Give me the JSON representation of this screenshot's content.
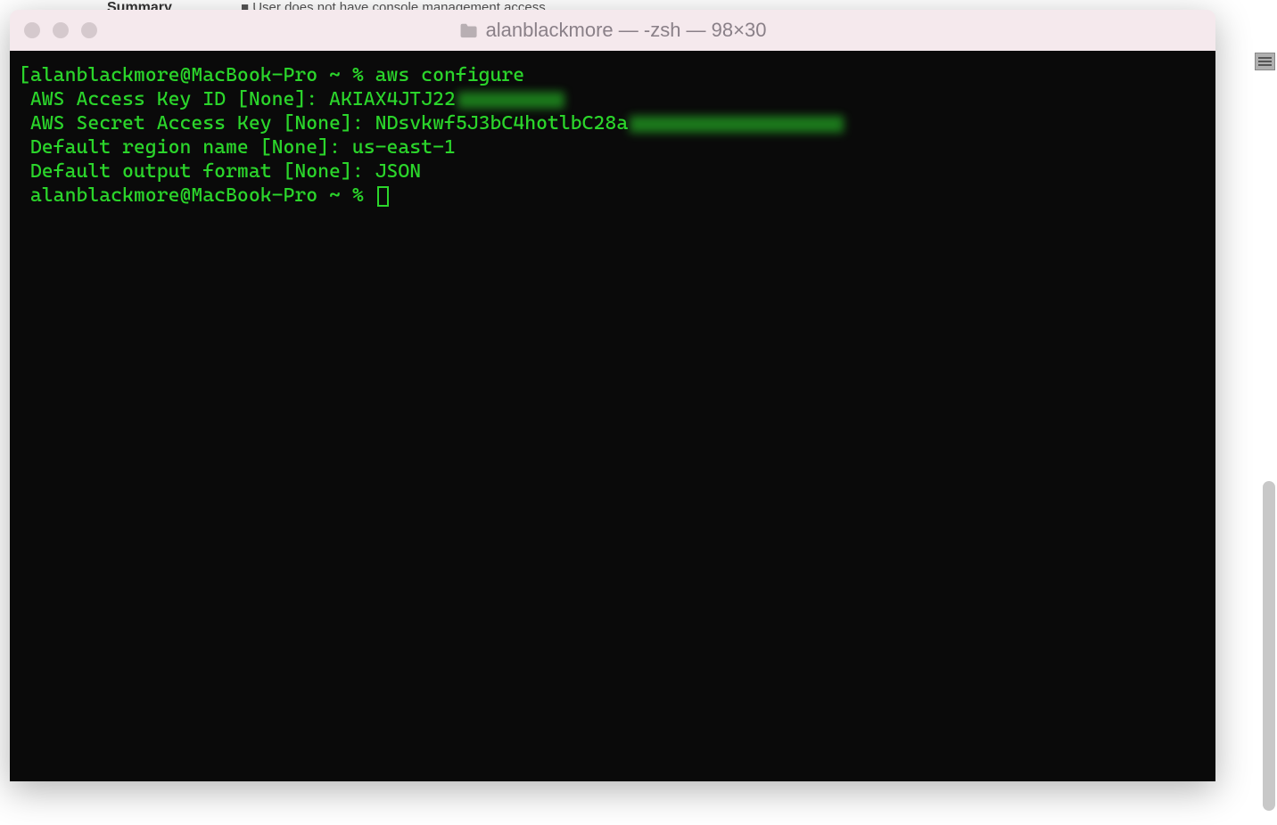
{
  "background": {
    "summary_label": "Summary",
    "summary_bullet": "■ User does not have console management access"
  },
  "titlebar": {
    "title": "alanblackmore — -zsh — 98×30"
  },
  "terminal": {
    "line1_prefix": "[",
    "line1_prompt": "alanblackmore@MacBook-Pro ~ % ",
    "line1_command": "aws configure",
    "line1_suffix": "]",
    "line2_label": "AWS Access Key ID [None]: ",
    "line2_value": "AKIAX4JTJ22",
    "line3_label": "AWS Secret Access Key [None]: ",
    "line3_value": "NDsvkwf5J3bC4hotlbC28a",
    "line4_label": "Default region name [None]: ",
    "line4_value": "us-east-1",
    "line5_label": "Default output format [None]: ",
    "line5_value": "JSON",
    "line6_prompt": "alanblackmore@MacBook-Pro ~ % "
  }
}
